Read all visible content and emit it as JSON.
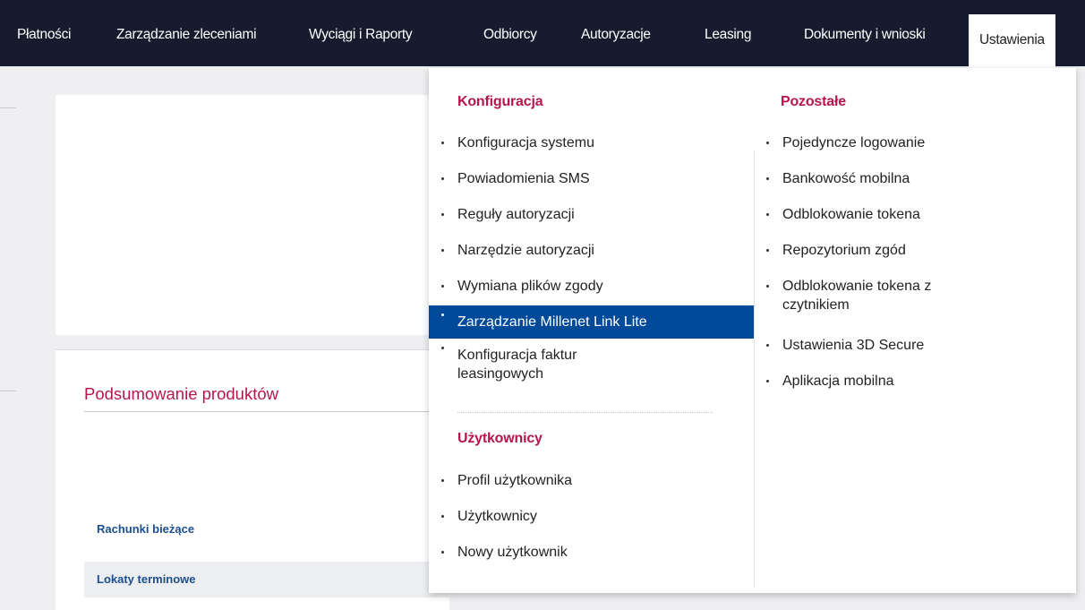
{
  "nav": {
    "items": [
      {
        "label": "Płatności"
      },
      {
        "label": "Zarządzanie zleceniami"
      },
      {
        "label": "Wyciągi i Raporty"
      },
      {
        "label": "Odbiorcy"
      },
      {
        "label": "Autoryzacje"
      },
      {
        "label": "Leasing"
      },
      {
        "label": "Dokumenty i wnioski"
      },
      {
        "label": "Ustawienia",
        "active": true
      }
    ]
  },
  "dropdown": {
    "konfiguracja": {
      "heading": "Konfiguracja",
      "items": [
        {
          "label": "Konfiguracja systemu"
        },
        {
          "label": "Powiadomienia SMS"
        },
        {
          "label": "Reguły autoryzacji"
        },
        {
          "label": "Narzędzie autoryzacji"
        },
        {
          "label": "Wymiana plików zgody"
        },
        {
          "label": "Zarządzanie Millenet Link Lite",
          "selected": true
        },
        {
          "label": "Konfiguracja faktur leasingowych"
        }
      ]
    },
    "uzytkownicy": {
      "heading": "Użytkownicy",
      "items": [
        {
          "label": "Profil użytkownika"
        },
        {
          "label": "Użytkownicy"
        },
        {
          "label": "Nowy użytkownik"
        }
      ]
    },
    "pozostale": {
      "heading": "Pozostałe",
      "items": [
        {
          "label": "Pojedyncze logowanie"
        },
        {
          "label": "Bankowość mobilna"
        },
        {
          "label": "Odblokowanie tokena"
        },
        {
          "label": "Repozytorium zgód"
        },
        {
          "label": "Odblokowanie tokena z czytnikiem"
        },
        {
          "label": "Ustawienia 3D Secure"
        },
        {
          "label": "Aplikacja mobilna"
        }
      ]
    }
  },
  "summary": {
    "title": "Podsumowanie produktów",
    "rows": [
      {
        "label": "Rachunki bieżące"
      },
      {
        "label": "Lokaty terminowe"
      }
    ]
  },
  "colors": {
    "nav_bg": "#161c2e",
    "accent": "#b8154e",
    "selected_bg": "#004a99",
    "link": "#1b4f8d"
  }
}
